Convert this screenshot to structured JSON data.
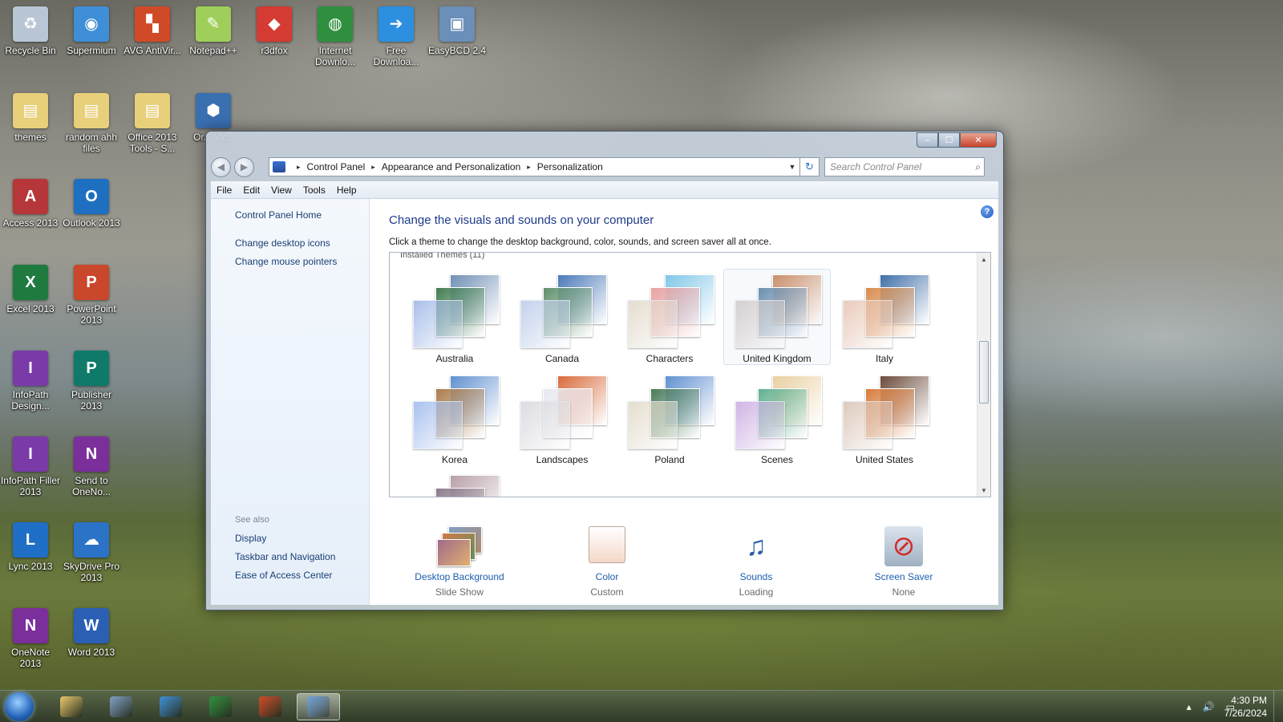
{
  "desktop": {
    "icons": [
      {
        "label": "Recycle Bin",
        "icon": "recycle-bin-icon",
        "color": "#b8c6d6",
        "glyph": "♻"
      },
      {
        "label": "Supermium",
        "icon": "supermium-browser-icon",
        "color": "#3f8fd8",
        "glyph": "◉"
      },
      {
        "label": "AVG AntiVir...",
        "icon": "avg-antivirus-icon",
        "color": "#d04a28",
        "glyph": "▚"
      },
      {
        "label": "Notepad++",
        "icon": "notepad-plus-plus-icon",
        "color": "#9fcf5a",
        "glyph": "✎"
      },
      {
        "label": "r3dfox",
        "icon": "r3dfox-icon",
        "color": "#d43b32",
        "glyph": "◆"
      },
      {
        "label": "Internet Downlo...",
        "icon": "internet-download-manager-icon",
        "color": "#2f8f3f",
        "glyph": "◍"
      },
      {
        "label": "Free Downloa...",
        "icon": "free-download-manager-icon",
        "color": "#2c8fe0",
        "glyph": "➔"
      },
      {
        "label": "EasyBCD 2.4",
        "icon": "easybcd-icon",
        "color": "#6a8fb8",
        "glyph": "▣"
      },
      {
        "label": "themes",
        "icon": "folder-icon",
        "color": "#e8cf7a",
        "glyph": "▤"
      },
      {
        "label": "random ahh files",
        "icon": "folder-icon",
        "color": "#e8cf7a",
        "glyph": "▤"
      },
      {
        "label": "Office 2013 Tools - S...",
        "icon": "folder-icon",
        "color": "#e8cf7a",
        "glyph": "▤"
      },
      {
        "label": "Or... Vir...",
        "icon": "virtualbox-icon",
        "color": "#3a6fb0",
        "glyph": "⬢"
      },
      {
        "label": "Access 2013",
        "icon": "access-icon",
        "color": "#b6363a",
        "glyph": "A"
      },
      {
        "label": "Outlook 2013",
        "icon": "outlook-icon",
        "color": "#1e6fc0",
        "glyph": "O"
      },
      {
        "label": "Excel 2013",
        "icon": "excel-icon",
        "color": "#1f7a3f",
        "glyph": "X"
      },
      {
        "label": "PowerPoint 2013",
        "icon": "powerpoint-icon",
        "color": "#c9472a",
        "glyph": "P"
      },
      {
        "label": "InfoPath Design...",
        "icon": "infopath-designer-icon",
        "color": "#7a3aa8",
        "glyph": "I"
      },
      {
        "label": "Publisher 2013",
        "icon": "publisher-icon",
        "color": "#0f7a6a",
        "glyph": "P"
      },
      {
        "label": "InfoPath Filler 2013",
        "icon": "infopath-filler-icon",
        "color": "#7a3aa8",
        "glyph": "I"
      },
      {
        "label": "Send to OneNo...",
        "icon": "send-to-onenote-icon",
        "color": "#7a2f9a",
        "glyph": "N"
      },
      {
        "label": "Lync 2013",
        "icon": "lync-icon",
        "color": "#1f6fc6",
        "glyph": "L"
      },
      {
        "label": "SkyDrive Pro 2013",
        "icon": "skydrive-pro-icon",
        "color": "#2b73c7",
        "glyph": "☁"
      },
      {
        "label": "OneNote 2013",
        "icon": "onenote-icon",
        "color": "#7a2f9a",
        "glyph": "N"
      },
      {
        "label": "Word 2013",
        "icon": "word-icon",
        "color": "#2b5fb4",
        "glyph": "W"
      }
    ]
  },
  "window": {
    "title": "",
    "controls": {
      "minimize": "–",
      "maximize": "☐",
      "close": "✕"
    },
    "nav": {
      "back": "◀",
      "forward": "▶"
    },
    "breadcrumb": [
      "Control Panel",
      "Appearance and Personalization",
      "Personalization"
    ],
    "breadcrumb_sep": "▸",
    "dropdown": "▼",
    "refresh": "↻",
    "search": {
      "placeholder": "Search Control Panel",
      "icon": "⌕"
    },
    "menu": [
      "File",
      "Edit",
      "View",
      "Tools",
      "Help"
    ],
    "help": "?"
  },
  "left_pane": {
    "links": [
      "Control Panel Home",
      "Change desktop icons",
      "Change mouse pointers"
    ],
    "see_also_heading": "See also",
    "see_also": [
      "Display",
      "Taskbar and Navigation",
      "Ease of Access Center"
    ]
  },
  "main": {
    "title": "Change the visuals and sounds on your computer",
    "subtitle": "Click a theme to change the desktop background, color, sounds, and screen saver all at once.",
    "installed_label": "Installed Themes (11)",
    "themes": [
      {
        "name": "Australia",
        "colors": [
          "#6f8fb5",
          "#3f7a4f",
          "#9bb4e6"
        ]
      },
      {
        "name": "Canada",
        "colors": [
          "#4a79b8",
          "#5f8f6a",
          "#b8c9e8"
        ]
      },
      {
        "name": "Characters",
        "colors": [
          "#7fc7e8",
          "#e8a0a0",
          "#e0d6c6"
        ]
      },
      {
        "name": "United Kingdom",
        "colors": [
          "#c98f6a",
          "#6a8fb0",
          "#cfc8c8"
        ]
      },
      {
        "name": "Italy",
        "colors": [
          "#3f6fa8",
          "#d88a4a",
          "#e6c2b0"
        ]
      },
      {
        "name": "Korea",
        "colors": [
          "#5f8fd0",
          "#a87a4a",
          "#9bb8ec"
        ]
      },
      {
        "name": "Landscapes",
        "colors": [
          "#d86a3a",
          "#e8e8f0",
          "#d6d6dc"
        ]
      },
      {
        "name": "Poland",
        "colors": [
          "#5f8fd0",
          "#4a7a5a",
          "#e0d8c6"
        ]
      },
      {
        "name": "Scenes",
        "colors": [
          "#e8d0a0",
          "#5fb08f",
          "#c8a8e0"
        ]
      },
      {
        "name": "United States",
        "colors": [
          "#6a4a3a",
          "#d87a3a",
          "#d8c0b0"
        ]
      },
      {
        "name": "",
        "colors": [
          "#b8a0a8",
          "#8a7a8a",
          "#c8c0c8"
        ]
      }
    ],
    "selected_theme": "United Kingdom",
    "scroll": {
      "up": "▲",
      "down": "▼",
      "grip": "≡"
    },
    "bottom": [
      {
        "label": "Desktop Background",
        "value": "Slide Show",
        "icon": "desktop-background-icon"
      },
      {
        "label": "Color",
        "value": "Custom",
        "icon": "window-color-icon",
        "swatch": "#f4d8c8"
      },
      {
        "label": "Sounds",
        "value": "Loading",
        "icon": "sounds-icon",
        "glyph": "♫"
      },
      {
        "label": "Screen Saver",
        "value": "None",
        "icon": "screen-saver-icon",
        "glyph": "⊘"
      }
    ]
  },
  "taskbar": {
    "apps": [
      {
        "icon": "explorer-icon",
        "color": "#e8c66a"
      },
      {
        "icon": "computer-icon",
        "color": "#7f9fc8"
      },
      {
        "icon": "supermium-browser-icon",
        "color": "#3f8fd8"
      },
      {
        "icon": "internet-download-manager-icon",
        "color": "#2f8f3f"
      },
      {
        "icon": "avg-antivirus-icon",
        "color": "#d04a28"
      },
      {
        "icon": "control-panel-icon",
        "color": "#6f9fd8",
        "active": true
      }
    ],
    "tray": {
      "arrow": "▴",
      "volume": "🔊",
      "network": "▭"
    },
    "time": "4:30 PM",
    "date": "7/26/2024"
  }
}
